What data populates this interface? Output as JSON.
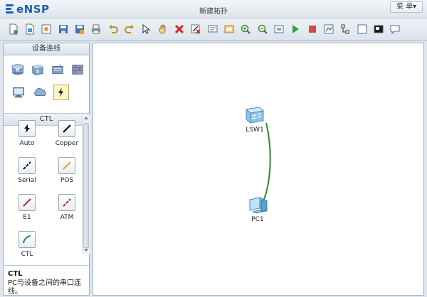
{
  "app": {
    "logo_text": "eNSP",
    "window_title": "新建拓扑",
    "menu_label": "菜 单▾"
  },
  "toolbar": {
    "tools": [
      {
        "name": "new-topology-icon"
      },
      {
        "name": "new-example-icon"
      },
      {
        "name": "open-icon"
      },
      {
        "name": "save-icon"
      },
      {
        "name": "save-as-icon"
      },
      {
        "name": "print-icon"
      },
      {
        "name": "undo-icon"
      },
      {
        "name": "redo-icon"
      },
      {
        "name": "select-pointer-icon"
      },
      {
        "name": "hand-pan-icon"
      },
      {
        "name": "delete-icon"
      },
      {
        "name": "delete-all-links-icon"
      },
      {
        "name": "text-note-icon"
      },
      {
        "name": "palette-icon"
      },
      {
        "name": "zoom-in-icon"
      },
      {
        "name": "zoom-out-icon"
      },
      {
        "name": "fit-view-icon"
      },
      {
        "name": "start-device-icon"
      },
      {
        "name": "stop-device-icon"
      },
      {
        "name": "capture-icon"
      },
      {
        "name": "topology-icon"
      },
      {
        "name": "grid-icon"
      },
      {
        "name": "terminal-icon"
      },
      {
        "name": "chat-icon"
      }
    ]
  },
  "left_panel": {
    "devices_header": "设备连线",
    "devices": [
      {
        "name": "router-device-icon"
      },
      {
        "name": "switch-device-icon"
      },
      {
        "name": "wlan-device-icon"
      },
      {
        "name": "firewall-device-icon"
      },
      {
        "name": "pc-device-icon"
      },
      {
        "name": "cloud-device-icon"
      },
      {
        "name": "cable-device-icon",
        "selected": true
      }
    ],
    "cables_header": "CTL",
    "cables": [
      {
        "label": "Auto",
        "icon": "auto-cable-icon"
      },
      {
        "label": "Copper",
        "icon": "copper-cable-icon"
      },
      {
        "label": "Serial",
        "icon": "serial-cable-icon"
      },
      {
        "label": "POS",
        "icon": "pos-cable-icon"
      },
      {
        "label": "E1",
        "icon": "e1-cable-icon"
      },
      {
        "label": "ATM",
        "icon": "atm-cable-icon"
      },
      {
        "label": "CTL",
        "icon": "ctl-cable-icon"
      }
    ],
    "description": {
      "title": "CTL",
      "text": "PC与设备之间的串口连线。"
    }
  },
  "canvas": {
    "nodes": [
      {
        "label": "LSW1",
        "icon": "switch-icon"
      },
      {
        "label": "PC1",
        "icon": "pc-icon"
      }
    ],
    "colors": {
      "link": "#2f8a3a"
    }
  }
}
